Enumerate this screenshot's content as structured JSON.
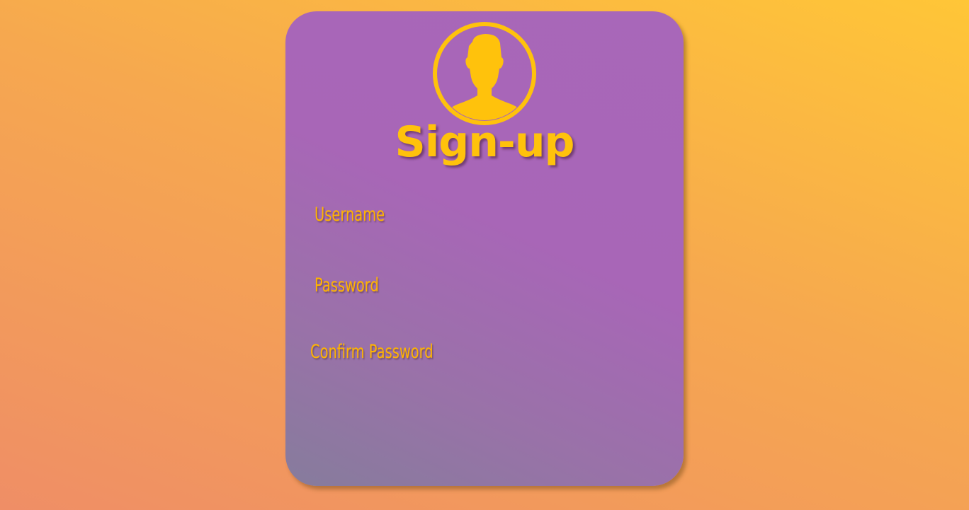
{
  "signup_card": {
    "title": "Sign-up",
    "avatar_icon": "user-silhouette-icon",
    "fields": {
      "username": {
        "placeholder": "Username",
        "value": ""
      },
      "password": {
        "placeholder": "Password",
        "value": ""
      },
      "confirm_password": {
        "placeholder": "Confirm Password",
        "value": ""
      }
    }
  },
  "colors": {
    "accent": "#ffc20c",
    "card": "#a866b7",
    "background_top": "#ffc637",
    "background_bottom": "#ef8e66"
  }
}
